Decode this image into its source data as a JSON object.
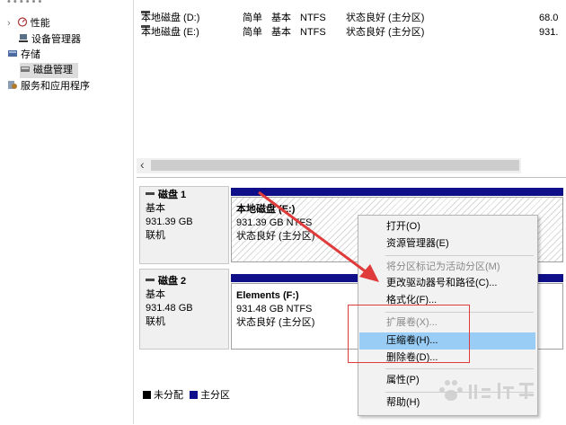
{
  "tree": {
    "items": [
      {
        "label": "性能",
        "icon": "performance-icon"
      },
      {
        "label": "设备管理器",
        "icon": "device-manager-icon"
      },
      {
        "label": "存储",
        "icon": "storage-icon"
      },
      {
        "label": "磁盘管理",
        "icon": "disk-management-icon"
      },
      {
        "label": "服务和应用程序",
        "icon": "services-icon"
      }
    ]
  },
  "volumes": [
    {
      "name": "本地磁盘 (D:)",
      "layout": "简单",
      "type": "基本",
      "fs": "NTFS",
      "status": "状态良好 (主分区)",
      "capacity": "68.0"
    },
    {
      "name": "本地磁盘 (E:)",
      "layout": "简单",
      "type": "基本",
      "fs": "NTFS",
      "status": "状态良好 (主分区)",
      "capacity": "931."
    }
  ],
  "scroll": {
    "left_arrow": "‹"
  },
  "disks": [
    {
      "name": "磁盘 1",
      "type": "基本",
      "size": "931.39 GB",
      "state": "联机",
      "partition": {
        "name": "本地磁盘 (E:)",
        "size": "931.39 GB NTFS",
        "status": "状态良好 (主分区)"
      }
    },
    {
      "name": "磁盘 2",
      "type": "基本",
      "size": "931.48 GB",
      "state": "联机",
      "partition": {
        "name": "Elements (F:)",
        "size": "931.48 GB NTFS",
        "status": "状态良好 (主分区)"
      }
    }
  ],
  "legend": {
    "unallocated": "未分配",
    "primary": "主分区",
    "unallocated_color": "#000000",
    "primary_color": "#0f0f8a"
  },
  "context_menu": {
    "open": "打开(O)",
    "explorer": "资源管理器(E)",
    "mark_active": "将分区标记为活动分区(M)",
    "change_letter": "更改驱动器号和路径(C)...",
    "format": "格式化(F)...",
    "extend": "扩展卷(X)...",
    "shrink": "压缩卷(H)...",
    "delete": "删除卷(D)...",
    "properties": "属性(P)",
    "help": "帮助(H)"
  },
  "colors": {
    "annotation_red": "#e03b3b",
    "highlight": "#99cdf5"
  }
}
